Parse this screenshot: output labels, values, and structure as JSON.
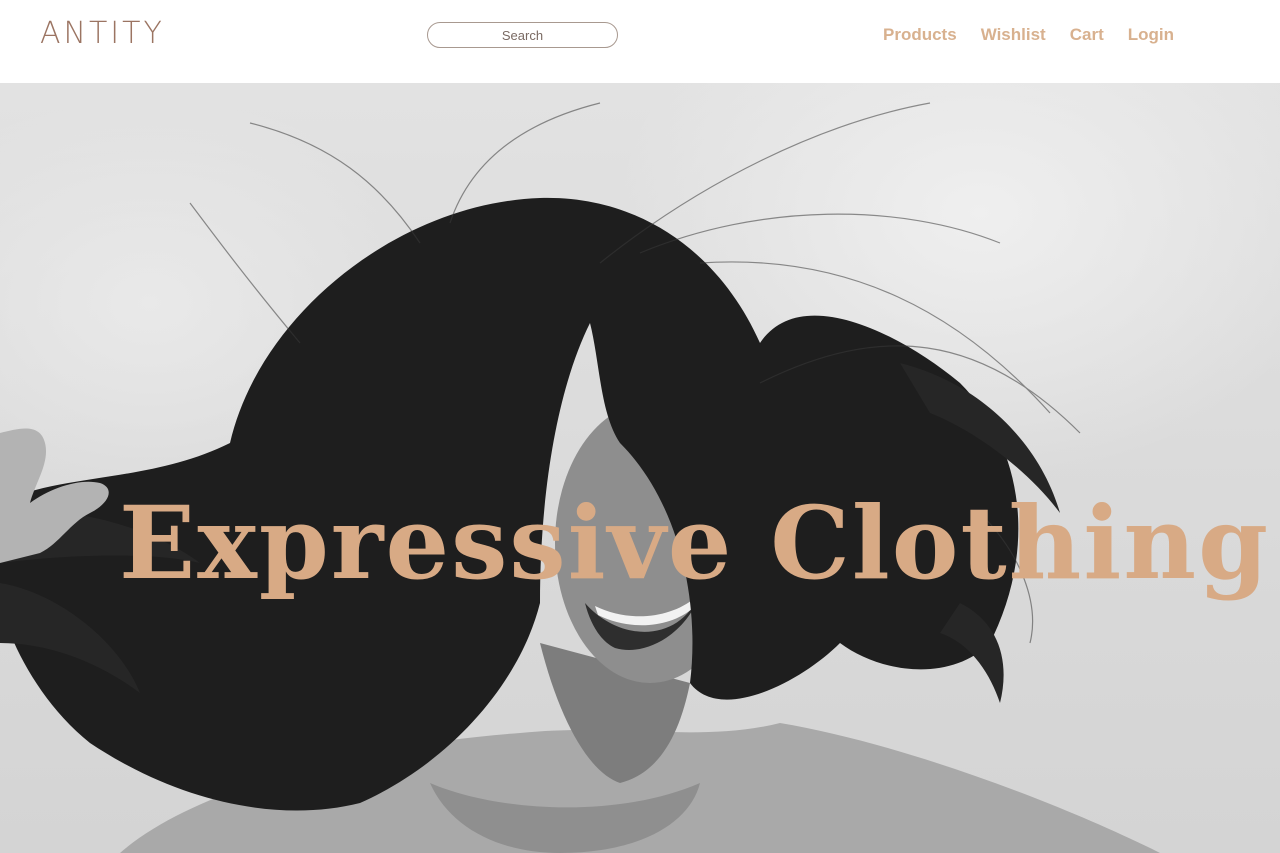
{
  "header": {
    "logo": "ANTITY",
    "search_placeholder": "Search",
    "nav": {
      "products": "Products",
      "wishlist": "Wishlist",
      "cart": "Cart",
      "login": "Login"
    }
  },
  "hero": {
    "title": "Expressive Clothing"
  },
  "colors": {
    "accent": "#d8b18f",
    "hero_title": "#d8aa85",
    "logo": "#9b7462"
  }
}
